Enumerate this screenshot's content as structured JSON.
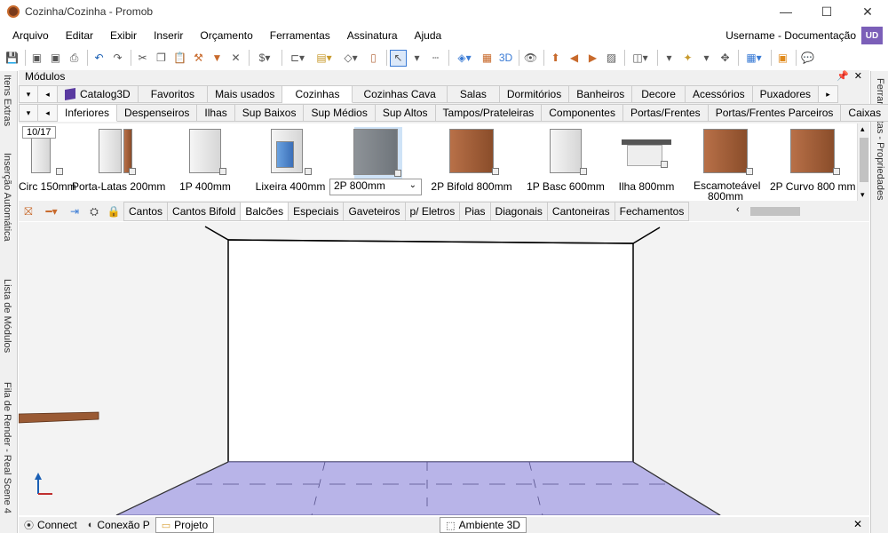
{
  "window": {
    "title": "Cozinha/Cozinha - Promob",
    "minimize": "—",
    "maximize": "☐",
    "close": "✕"
  },
  "menu": [
    "Arquivo",
    "Editar",
    "Exibir",
    "Inserir",
    "Orçamento",
    "Ferramentas",
    "Assinatura",
    "Ajuda"
  ],
  "user": {
    "name": "Username - Documentação",
    "initials": "UD",
    "badge_color": "#7b5fb8"
  },
  "side_tabs_left": [
    "Itens Extras",
    "Inserção Automática",
    "Lista de Módulos",
    "Fila de Render - Real Scene 4"
  ],
  "side_tab_right": "Ferramentas - Propriedades",
  "modules_panel": {
    "title": "Módulos",
    "pin": "📌",
    "close": "✕",
    "tabs_row1": [
      "Catalog3D",
      "Favoritos",
      "Mais usados",
      "Cozinhas",
      "Cozinhas Cava",
      "Salas",
      "Dormitórios",
      "Banheiros",
      "Decore",
      "Acessórios",
      "Puxadores"
    ],
    "tabs_row1_active": "Cozinhas",
    "tabs_row2": [
      "Inferiores",
      "Despenseiros",
      "Ilhas",
      "Sup Baixos",
      "Sup Médios",
      "Sup Altos",
      "Tampos/Prateleiras",
      "Componentes",
      "Portas/Frentes",
      "Portas/Frentes Parceiros",
      "Caixas"
    ],
    "tabs_row2_active": "Inferiores",
    "counter": "10/17",
    "modules": [
      {
        "label": "Circ 150mm",
        "material": "white"
      },
      {
        "label": "Porta-Latas 200mm",
        "material": "white-wood"
      },
      {
        "label": "1P 400mm",
        "material": "white"
      },
      {
        "label": "Lixeira 400mm",
        "material": "blue"
      },
      {
        "label": "2P 800mm",
        "material": "gray",
        "selected": true
      },
      {
        "label": "2P Bifold 800mm",
        "material": "wood"
      },
      {
        "label": "1P Basc 600mm",
        "material": "white"
      },
      {
        "label": "Ilha 800mm",
        "material": "table"
      },
      {
        "label": "Escamoteável 800mm",
        "material": "wood"
      },
      {
        "label": "2P Curvo 800 mm",
        "material": "wood"
      }
    ]
  },
  "sub_tabs": [
    "Cantos",
    "Cantos Bifold",
    "Balcões",
    "Especiais",
    "Gaveteiros",
    "p/ Eletros",
    "Pias",
    "Diagonais",
    "Cantoneiras",
    "Fechamentos"
  ],
  "sub_tabs_active": "Balcões",
  "status_tabs": [
    {
      "label": "Connect",
      "icon": "rss-icon"
    },
    {
      "label": "Conexão P",
      "icon": "promob-icon"
    },
    {
      "label": "Projeto",
      "icon": "folder-icon"
    }
  ],
  "viewport_tab": {
    "label": "Ambiente 3D",
    "icon": "cube-icon"
  },
  "colors": {
    "floor": "#b8b4e8",
    "selection": "#cfe3f7",
    "wood": "#9a5a34"
  }
}
